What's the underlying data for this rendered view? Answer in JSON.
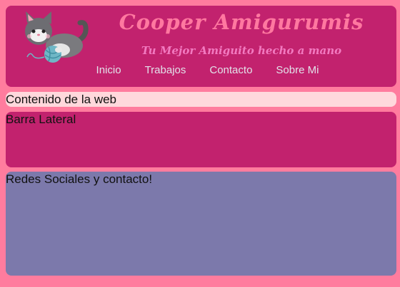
{
  "header": {
    "logo_icon": "cat-with-yarn-ball-icon",
    "title": "Cooper Amigurumis",
    "tagline": "Tu Mejor Amiguito hecho a mano",
    "nav": [
      {
        "label": "Inicio"
      },
      {
        "label": "Trabajos"
      },
      {
        "label": "Contacto"
      },
      {
        "label": "Sobre Mi"
      }
    ]
  },
  "content": {
    "text": "Contenido de la web"
  },
  "sidebar": {
    "text": "Barra Lateral"
  },
  "footer": {
    "text": "Redes Sociales y contacto!"
  },
  "colors": {
    "page_background": "#ff7c9e",
    "header_background": "#c2226e",
    "content_background": "#ffd8dc",
    "footer_background": "#7c79ab",
    "title_color": "#ff78a0"
  }
}
